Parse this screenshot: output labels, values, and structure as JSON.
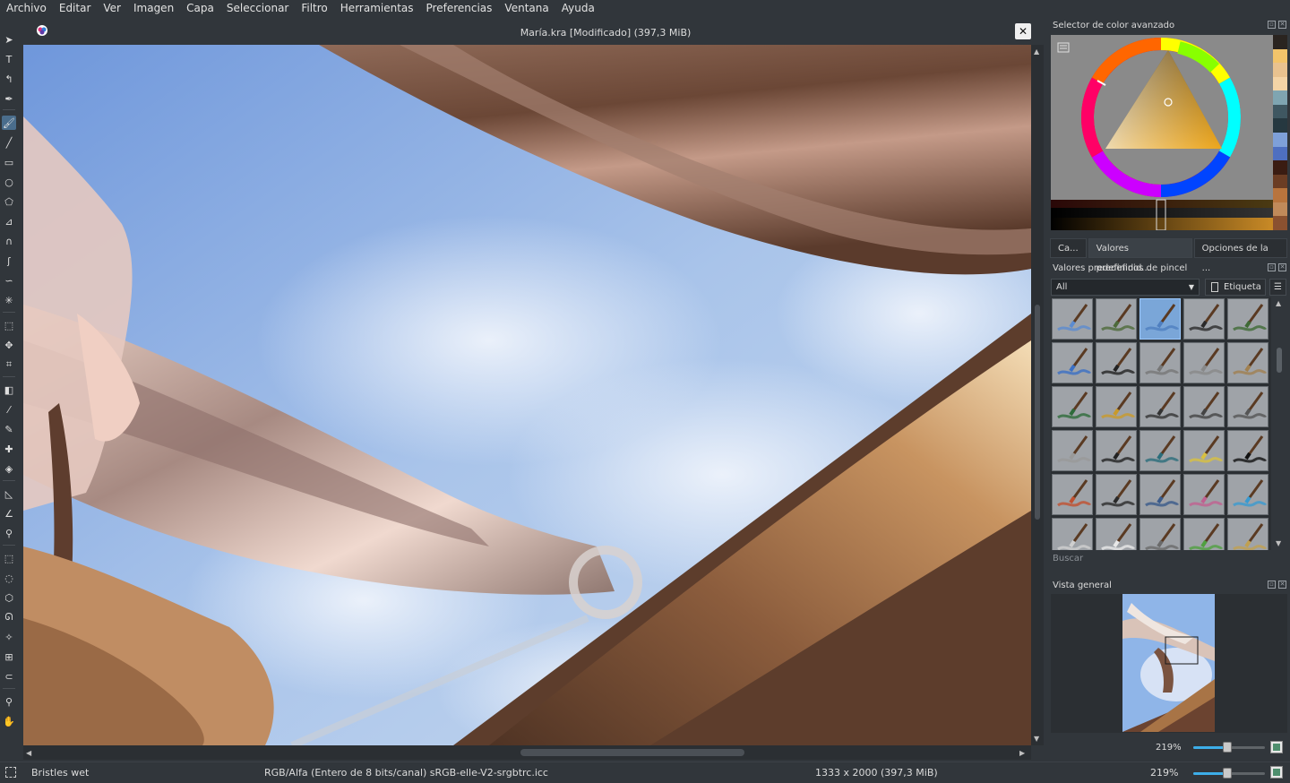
{
  "menu": [
    "Archivo",
    "Editar",
    "Ver",
    "Imagen",
    "Capa",
    "Seleccionar",
    "Filtro",
    "Herramientas",
    "Preferencias",
    "Ventana",
    "Ayuda"
  ],
  "document": {
    "title": "María.kra [Modificado]  (397,3 MiB)"
  },
  "color_panel": {
    "title": "Selector de color avanzado",
    "palette": [
      "#2a2420",
      "#f3c46a",
      "#e9c28f",
      "#f4d4a6",
      "#7fa5b1",
      "#3f5761",
      "#263840",
      "#7ea0d9",
      "#4e6fc0",
      "#3a1c12",
      "#6b3d24",
      "#b8743d",
      "#c08a5a",
      "#8a5130"
    ]
  },
  "tabs": [
    {
      "label": "Ca..."
    },
    {
      "label": "Valores predefinid..."
    },
    {
      "label": "Opciones de la ..."
    }
  ],
  "presets_panel": {
    "title": "Valores predefinidos de pincel",
    "filter_value": "All",
    "tag_label": "Etiqueta",
    "search_placeholder": "Buscar"
  },
  "overview_panel": {
    "title": "Vista general",
    "zoom": "219%"
  },
  "statusbar": {
    "brush": "Bristles wet",
    "colorspace": "RGB/Alfa (Entero de 8 bits/canal)  sRGB-elle-V2-srgbtrc.icc",
    "dimensions": "1333 x 2000 (397,3 MiB)",
    "zoom": "219%"
  }
}
